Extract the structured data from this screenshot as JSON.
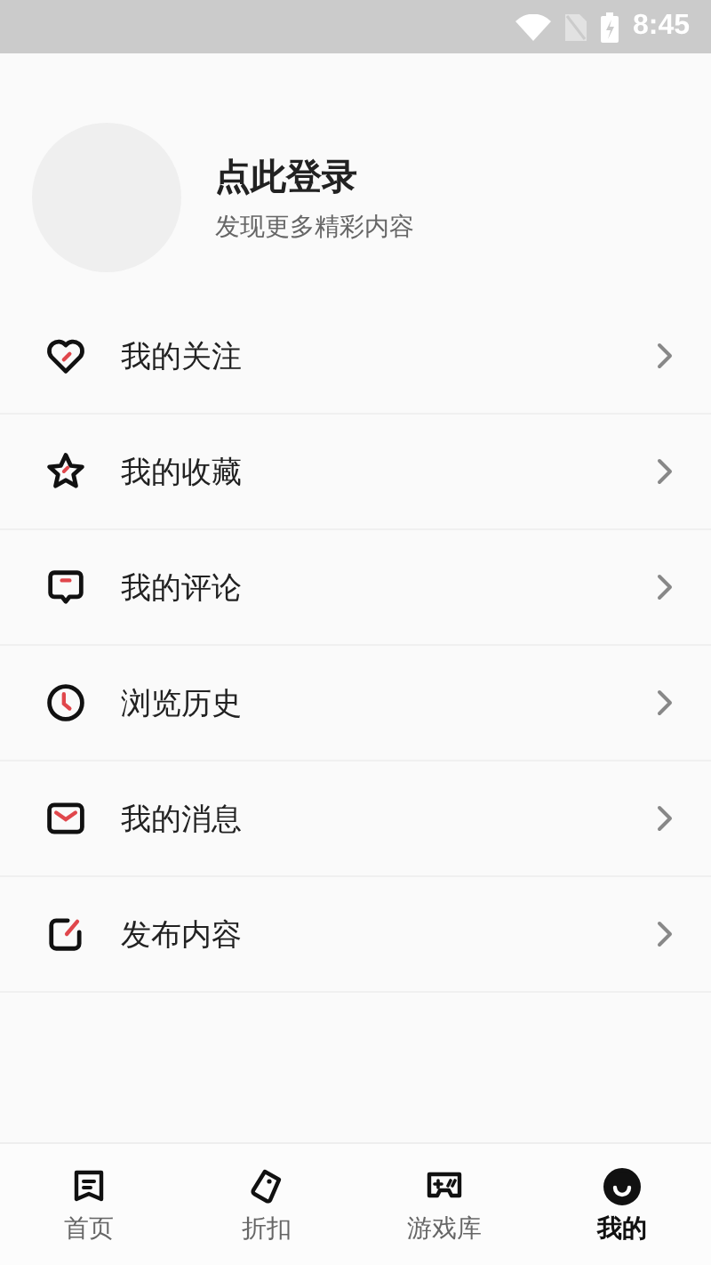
{
  "status_bar": {
    "time": "8:45"
  },
  "profile": {
    "title": "点此登录",
    "subtitle": "发现更多精彩内容"
  },
  "menu": [
    {
      "kind": "heart",
      "label": "我的关注"
    },
    {
      "kind": "star",
      "label": "我的收藏"
    },
    {
      "kind": "comment",
      "label": "我的评论"
    },
    {
      "kind": "clock",
      "label": "浏览历史"
    },
    {
      "kind": "mail",
      "label": "我的消息"
    },
    {
      "kind": "edit",
      "label": "发布内容"
    }
  ],
  "tabs": [
    {
      "kind": "home",
      "label": "首页",
      "selected": false
    },
    {
      "kind": "tag",
      "label": "折扣",
      "selected": false
    },
    {
      "kind": "game",
      "label": "游戏库",
      "selected": false
    },
    {
      "kind": "profile",
      "label": "我的",
      "selected": true
    }
  ]
}
